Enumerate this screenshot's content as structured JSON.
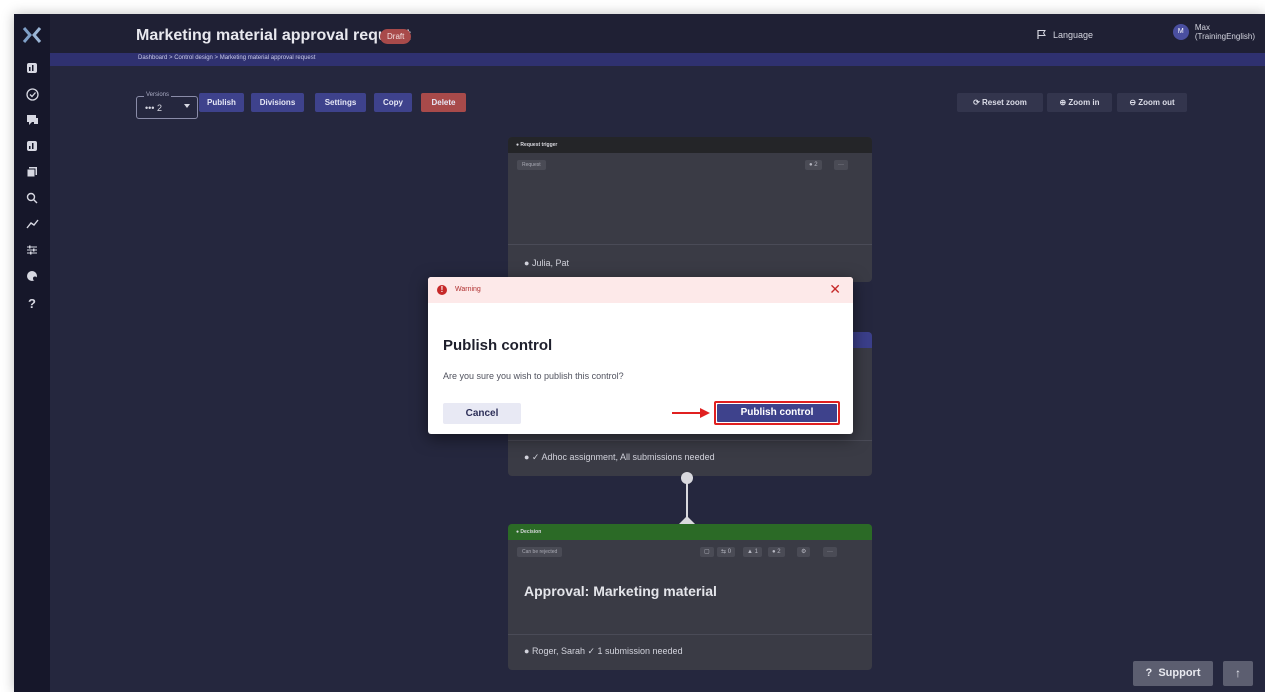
{
  "header": {
    "title": "Marketing material approval request",
    "badge": "Draft",
    "language_label": "Language",
    "user_initial": "M",
    "user_name_line1": "Max",
    "user_name_line2": "(TrainingEnglish)"
  },
  "breadcrumb": {
    "text": "Dashboard  >  Control design  >  Marketing material approval request"
  },
  "toolbar": {
    "versions_label": "Versions",
    "versions_value": "••• 2",
    "publish": "Publish",
    "divisions": "Divisions",
    "settings": "Settings",
    "copy": "Copy",
    "delete": "Delete",
    "reset_zoom": "Reset zoom",
    "zoom_in": "Zoom in",
    "zoom_out": "Zoom out"
  },
  "cards": {
    "trigger": {
      "head": "Request trigger",
      "tag": "Request",
      "count": "2",
      "more": "···",
      "assignees": "Julia, Pat"
    },
    "middle": {
      "foot": "Adhoc assignment, All submissions needed"
    },
    "decision": {
      "head": "Decision",
      "tag": "Can be rejected",
      "chip_1": "0",
      "chip_2": "1",
      "chip_3": "2",
      "more": "···",
      "title": "Approval: Marketing material",
      "foot": "Roger, Sarah  ✓ 1 submission needed"
    }
  },
  "modal": {
    "header_label": "Warning",
    "title": "Publish control",
    "message": "Are you sure you wish to publish this control?",
    "cancel": "Cancel",
    "confirm": "Publish control"
  },
  "footer": {
    "support": "Support",
    "scroll_top": "↑"
  },
  "colors": {
    "background": "#25273e",
    "accent": "#3e428c",
    "danger": "#a84a4a",
    "decision_green": "#2b6a26",
    "highlight_red": "#e02020"
  }
}
